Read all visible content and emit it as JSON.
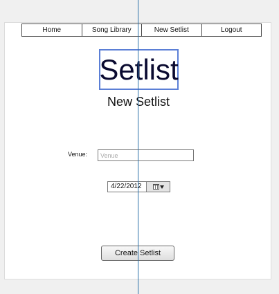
{
  "nav": {
    "items": [
      {
        "label": "Home"
      },
      {
        "label": "Song Library"
      },
      {
        "label": "New Setlist"
      },
      {
        "label": "Logout"
      }
    ]
  },
  "header": {
    "title": "Setlist",
    "subtitle": "New Setlist"
  },
  "form": {
    "venue_label": "Venue:",
    "venue_placeholder": "Venue",
    "venue_value": "",
    "date_value": "4/22/2012",
    "date_icon": "calendar-icon",
    "submit_label": "Create Setlist"
  },
  "colors": {
    "title_border": "#5b7fd6",
    "guide_line": "#2a6fa8"
  }
}
